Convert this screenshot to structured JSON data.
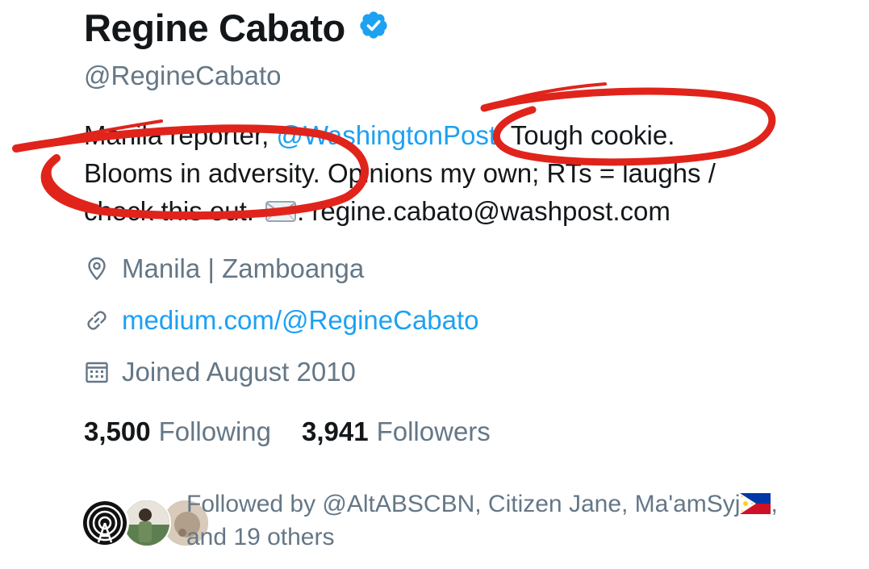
{
  "profile": {
    "display_name": "Regine Cabato",
    "handle": "@RegineCabato",
    "verified_icon": "verified-badge-icon",
    "bio": {
      "line1_prefix": "Manila reporter, ",
      "line1_mention": "@WashingtonPost",
      "line1_suffix": ". Tough cookie.",
      "line2": "Blooms in adversity. Opinions my own; RTs = laughs /",
      "line3_prefix": "check this out. ",
      "line3_email": ": regine.cabato@washpost.com",
      "envelope_icon": "envelope-emoji-icon"
    },
    "location": "Manila | Zamboanga",
    "website": "medium.com/@RegineCabato",
    "joined": "Joined August 2010",
    "icons": {
      "location": "location-pin-icon",
      "link": "link-icon",
      "calendar": "calendar-icon"
    }
  },
  "stats": {
    "following_count": "3,500",
    "following_label": "Following",
    "followers_count": "3,941",
    "followers_label": "Followers"
  },
  "followed_by": {
    "line1": "Followed by @AltABSCBN, Citizen Jane, Ma'amSyj",
    "line1_suffix": ",",
    "line2": "and 19 others",
    "flag_icon": "philippines-flag-icon"
  },
  "colors": {
    "text_primary": "#14171a",
    "text_secondary": "#657786",
    "link": "#1da1f2",
    "annotation_red": "#e0241b"
  }
}
